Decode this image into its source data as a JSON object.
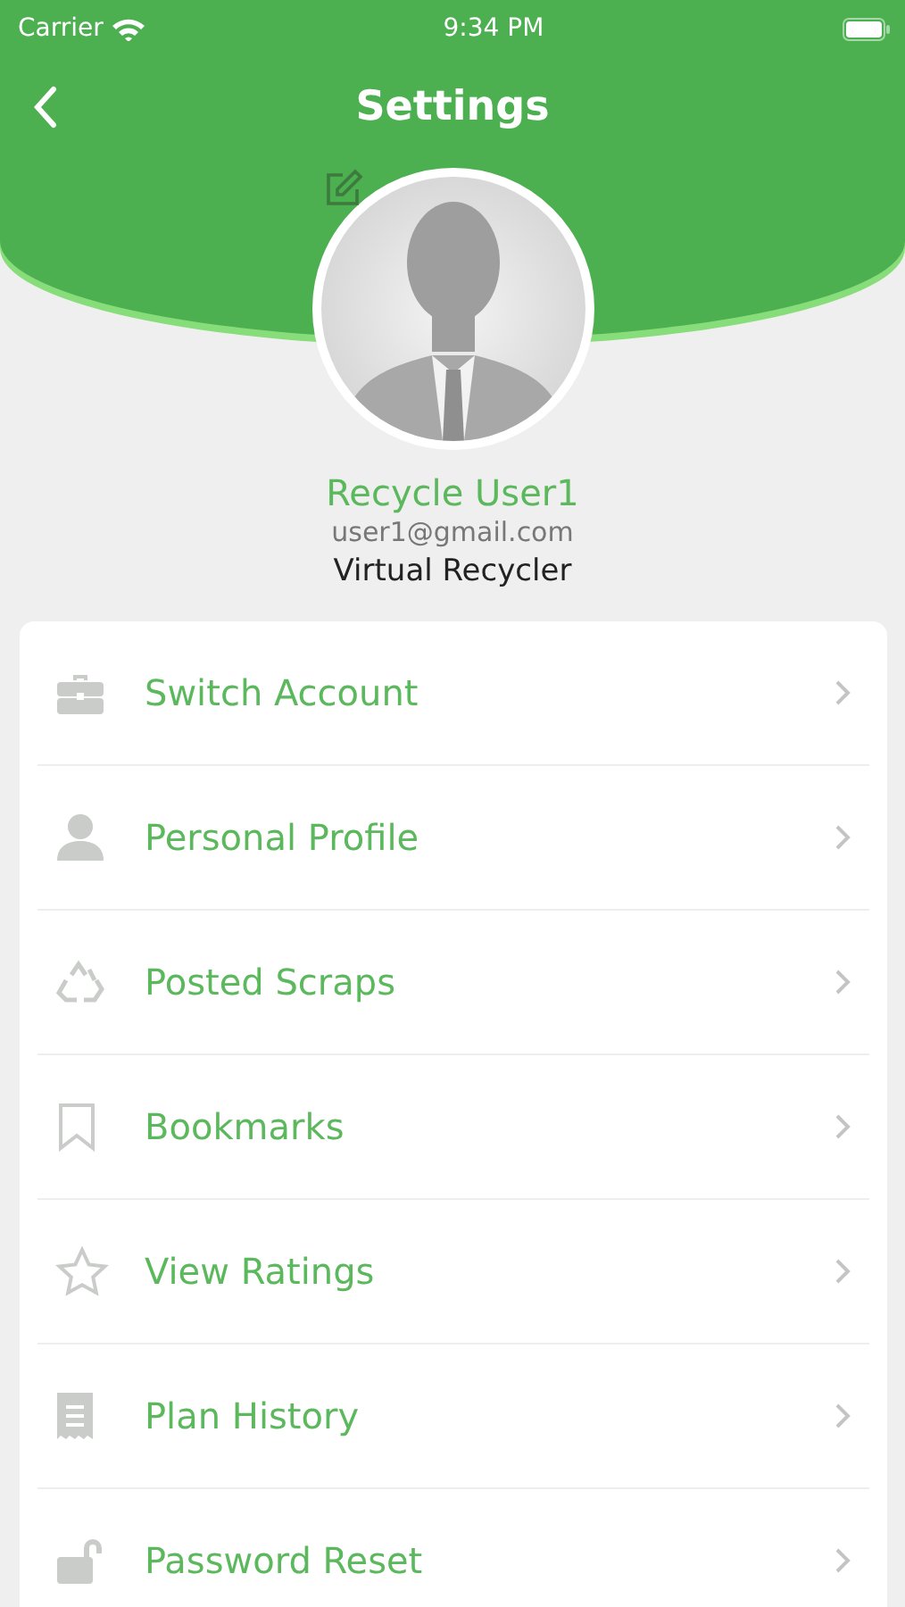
{
  "status_bar": {
    "carrier": "Carrier",
    "time": "9:34 PM"
  },
  "nav": {
    "title": "Settings"
  },
  "profile": {
    "name": "Recycle User1",
    "email": "user1@gmail.com",
    "role": "Virtual Recycler"
  },
  "menu": [
    {
      "label": "Switch Account"
    },
    {
      "label": "Personal Profile"
    },
    {
      "label": "Posted Scraps"
    },
    {
      "label": "Bookmarks"
    },
    {
      "label": "View Ratings"
    },
    {
      "label": "Plan History"
    },
    {
      "label": "Password Reset"
    }
  ]
}
